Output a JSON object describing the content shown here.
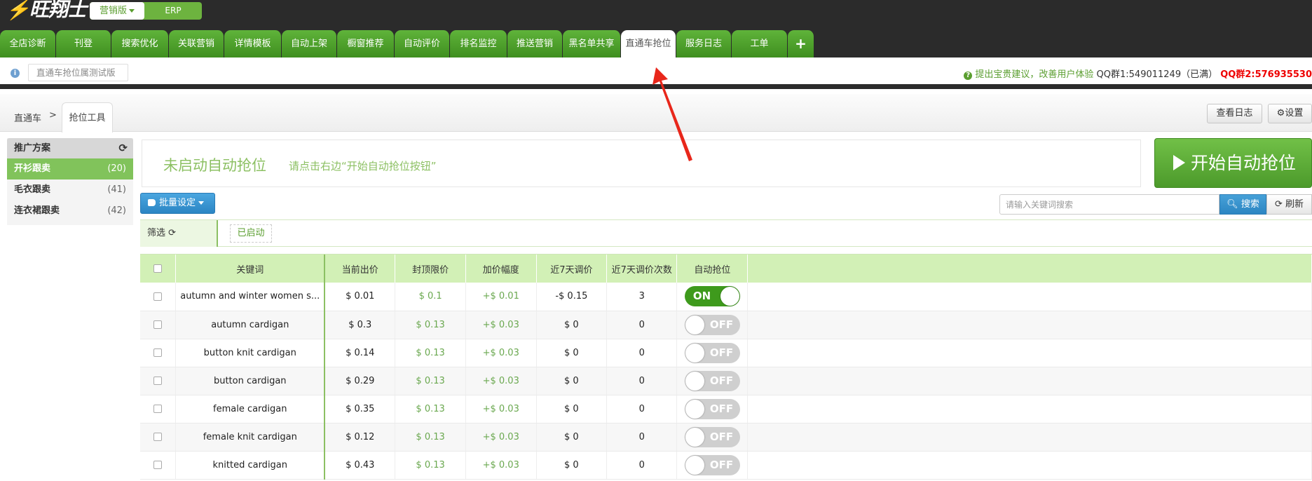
{
  "logo": {
    "text": "旺翔士"
  },
  "mode_switch": {
    "active": "营销版",
    "other": "ERP"
  },
  "nav_tabs": [
    "全店诊断",
    "刊登",
    "搜索优化",
    "关联营销",
    "详情模板",
    "自动上架",
    "橱窗推荐",
    "自动评价",
    "排名监控",
    "推送营销",
    "黑名单共享",
    "直通车抢位",
    "服务日志",
    "工单",
    "+"
  ],
  "nav_active": "直通车抢位",
  "info": {
    "version_label": "直通车抢位属测试版",
    "feedback": "提出宝贵建议，改善用户体验",
    "qq1": "QQ群1:549011249（已满）",
    "qq2": "QQ群2:576935530"
  },
  "breadcrumb": {
    "root": "直通车",
    "separator": ">",
    "current": "抢位工具"
  },
  "toolbar": {
    "view_log": "查看日志",
    "settings": "设置"
  },
  "sidebar": {
    "title": "推广方案",
    "items": [
      {
        "label": "开衫跟卖",
        "count": "(20)",
        "active": true
      },
      {
        "label": "毛衣跟卖",
        "count": "(41)",
        "active": false
      },
      {
        "label": "连衣裙跟卖",
        "count": "(42)",
        "active": false
      }
    ]
  },
  "status": {
    "title": "未启动自动抢位",
    "hint": "请点击右边“开始自动抢位按钮”"
  },
  "start_button": "开始自动抢位",
  "batch_button": "批量设定",
  "search": {
    "placeholder": "请输入关键词搜索",
    "button": "搜索",
    "refresh": "刷新"
  },
  "filter": {
    "label": "筛选",
    "chip": "已启动"
  },
  "table": {
    "headers": [
      "关键词",
      "当前出价",
      "封顶限价",
      "加价幅度",
      "近7天调价",
      "近7天调价次数",
      "自动抢位"
    ],
    "rows": [
      {
        "keyword": "autumn and winter women s...",
        "price": "$ 0.01",
        "cap": "$ 0.1",
        "step": "+$ 0.01",
        "change7": "-$ 0.15",
        "count7": "3",
        "auto": "ON"
      },
      {
        "keyword": "autumn cardigan",
        "price": "$ 0.3",
        "cap": "$ 0.13",
        "step": "+$ 0.03",
        "change7": "$ 0",
        "count7": "0",
        "auto": "OFF"
      },
      {
        "keyword": "button knit cardigan",
        "price": "$ 0.14",
        "cap": "$ 0.13",
        "step": "+$ 0.03",
        "change7": "$ 0",
        "count7": "0",
        "auto": "OFF"
      },
      {
        "keyword": "button cardigan",
        "price": "$ 0.29",
        "cap": "$ 0.13",
        "step": "+$ 0.03",
        "change7": "$ 0",
        "count7": "0",
        "auto": "OFF"
      },
      {
        "keyword": "female cardigan",
        "price": "$ 0.35",
        "cap": "$ 0.13",
        "step": "+$ 0.03",
        "change7": "$ 0",
        "count7": "0",
        "auto": "OFF"
      },
      {
        "keyword": "female knit cardigan",
        "price": "$ 0.12",
        "cap": "$ 0.13",
        "step": "+$ 0.03",
        "change7": "$ 0",
        "count7": "0",
        "auto": "OFF"
      },
      {
        "keyword": "knitted cardigan",
        "price": "$ 0.43",
        "cap": "$ 0.13",
        "step": "+$ 0.03",
        "change7": "$ 0",
        "count7": "0",
        "auto": "OFF"
      }
    ]
  },
  "colors": {
    "brand_green": "#5fb33a",
    "accent_red": "#e00000",
    "toggle_on": "#3e9a1c",
    "link_blue": "#2c86c2"
  }
}
